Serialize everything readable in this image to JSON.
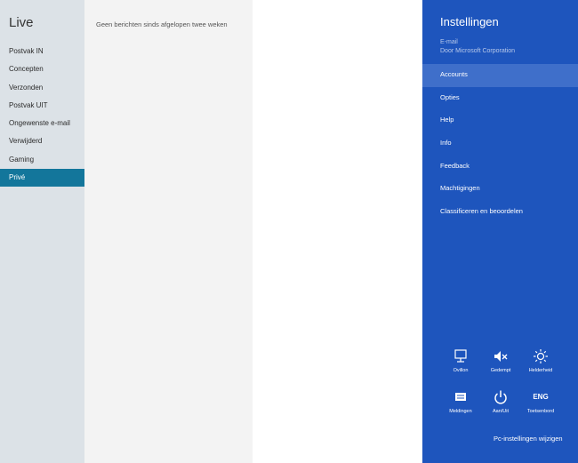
{
  "folders": {
    "account_title": "Live",
    "items": [
      {
        "label": "Postvak IN"
      },
      {
        "label": "Concepten"
      },
      {
        "label": "Verzonden"
      },
      {
        "label": "Postvak UIT"
      },
      {
        "label": "Ongewenste e-mail"
      },
      {
        "label": "Verwijderd"
      },
      {
        "label": "Gaming"
      },
      {
        "label": "Privé",
        "selected": true
      }
    ]
  },
  "message_list": {
    "empty_text": "Geen berichten sinds afgelopen twee weken"
  },
  "settings": {
    "title": "Instellingen",
    "app_name": "E-mail",
    "publisher": "Door Microsoft Corporation",
    "menu": [
      {
        "label": "Accounts",
        "selected": true
      },
      {
        "label": "Opties"
      },
      {
        "label": "Help"
      },
      {
        "label": "Info"
      },
      {
        "label": "Feedback"
      },
      {
        "label": "Machtigingen"
      },
      {
        "label": "Classificeren en beoordelen"
      }
    ],
    "tiles": [
      {
        "label": "Ovillon",
        "icon": "network-icon"
      },
      {
        "label": "Gedempt",
        "icon": "speaker-muted-icon"
      },
      {
        "label": "Helderheid",
        "icon": "brightness-icon"
      },
      {
        "label": "Meldingen",
        "icon": "notifications-icon"
      },
      {
        "label": "Aan/Uit",
        "icon": "power-icon"
      },
      {
        "label": "Toetsenbord",
        "icon": "keyboard-icon",
        "glyph": "ENG"
      }
    ],
    "pc_settings_link": "Pc-instellingen wijzigen"
  },
  "colors": {
    "folder_bg": "#dce2e7",
    "folder_selected": "#13769b",
    "list_bg": "#f3f3f3",
    "settings_bg": "#1e55bd",
    "settings_selected": "#3f6fca"
  }
}
